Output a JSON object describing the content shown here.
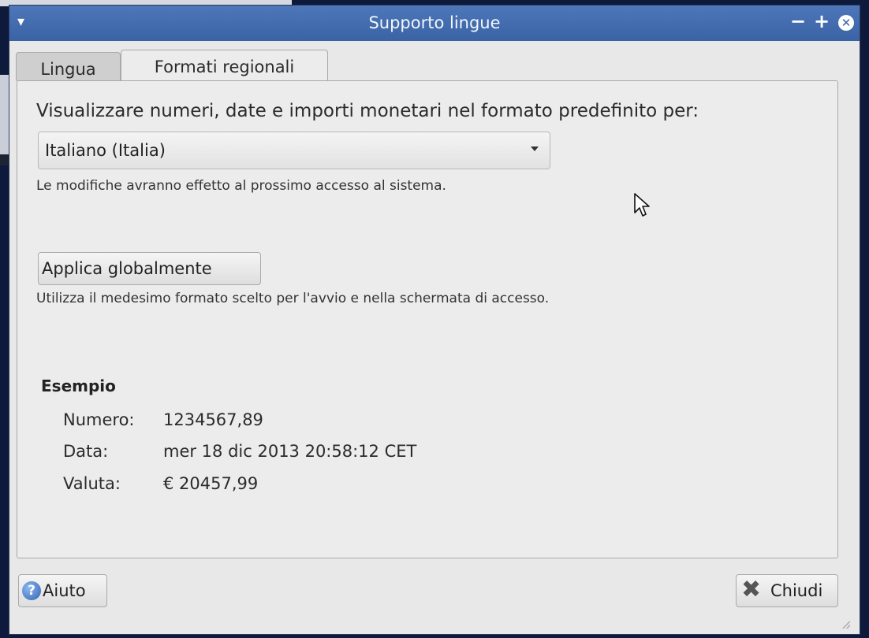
{
  "window": {
    "title": "Supporto lingue"
  },
  "tabs": [
    {
      "label": "Lingua",
      "selected": false
    },
    {
      "label": "Formati regionali",
      "selected": true
    }
  ],
  "formats": {
    "heading": "Visualizzare numeri, date e importi monetari nel formato predefinito per:",
    "selected_locale": "Italiano (Italia)",
    "note_relogin": "Le modifiche avranno effetto al prossimo accesso al sistema.",
    "apply_button_label": "Applica globalmente",
    "note_apply": "Utilizza il medesimo formato scelto per l'avvio e nella schermata di accesso."
  },
  "example": {
    "title": "Esempio",
    "rows": [
      {
        "label": "Numero:",
        "value": "1234567,89"
      },
      {
        "label": "Data:",
        "value": "mer 18 dic 2013 20:58:12 CET"
      },
      {
        "label": "Valuta:",
        "value": "€ 20457,99"
      }
    ]
  },
  "footer": {
    "help_label": "Aiuto",
    "close_label": "Chiudi"
  },
  "icons": {
    "menu": "window-menu-icon",
    "minimize": "minimize-icon",
    "maximize": "maximize-icon",
    "close": "close-window-icon",
    "help": "help-icon",
    "close_dialog": "close-x-icon",
    "dropdown": "chevron-down-icon"
  },
  "colors": {
    "titlebar": "#3f69ab",
    "window_bg": "#e8e8e8"
  }
}
